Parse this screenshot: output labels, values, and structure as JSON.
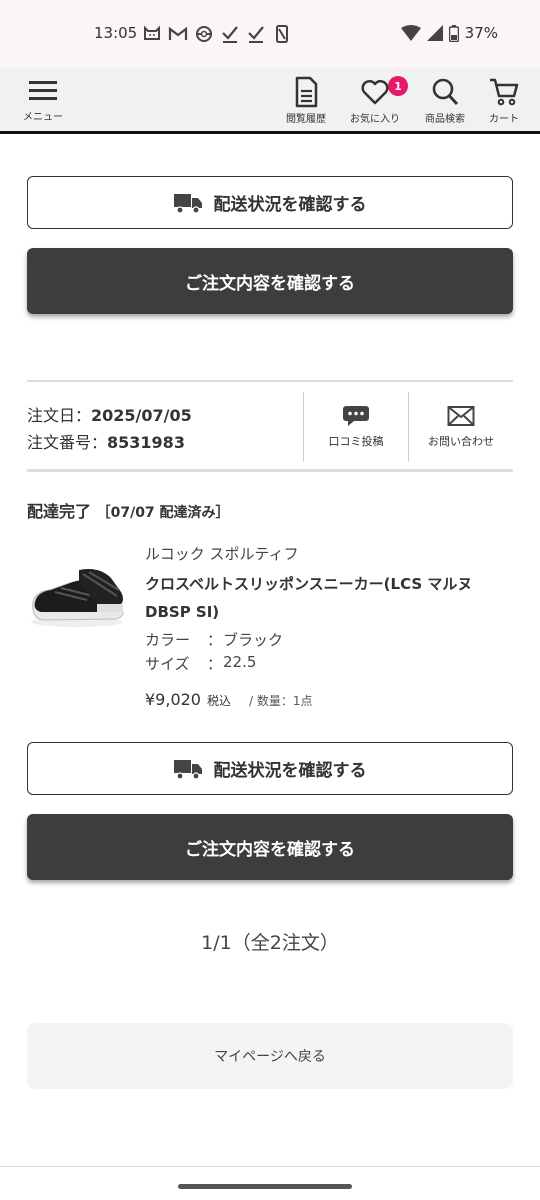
{
  "status_bar": {
    "time": "13:05",
    "battery": "37%",
    "icons": [
      "cat-icon",
      "gmail-icon",
      "pokeball-icon",
      "check-icon",
      "check-icon",
      "phone-slash-icon"
    ]
  },
  "header": {
    "menu_label": "メニュー",
    "history_label": "閲覧履歴",
    "favorites_label": "お気に入り",
    "favorites_badge": "1",
    "search_label": "商品検索",
    "cart_label": "カート"
  },
  "prev_order": {
    "price": "¥9,020",
    "tax_label": "税込",
    "qty": "/ 数量：1点",
    "track_button": "配送状況を確認する",
    "detail_button": "ご注文内容を確認する"
  },
  "order": {
    "date_label": "注文日：",
    "date": "2025/07/05",
    "number_label": "注文番号：",
    "number": "8531983",
    "review_label": "口コミ投稿",
    "contact_label": "お問い合わせ",
    "status": "配達完了",
    "status_detail": "［07/07 配達済み］",
    "item": {
      "brand": "ルコック スポルティフ",
      "name": "クロスベルトスリッポンスニーカー(LCS マルヌ DBSP SI)",
      "color_key": "カラー",
      "color_value": "ブラック",
      "size_key": "サイズ",
      "size_value": "22.5",
      "separator": "：",
      "price": "¥9,020",
      "tax_label": "税込",
      "qty": "/ 数量：1点"
    },
    "track_button": "配送状況を確認する",
    "detail_button": "ご注文内容を確認する"
  },
  "pagination": "1/1（全2注文）",
  "back_button": "マイページへ戻る",
  "colors": {
    "accent_badge": "#e8196b",
    "dark_button": "#3d3d3d"
  }
}
